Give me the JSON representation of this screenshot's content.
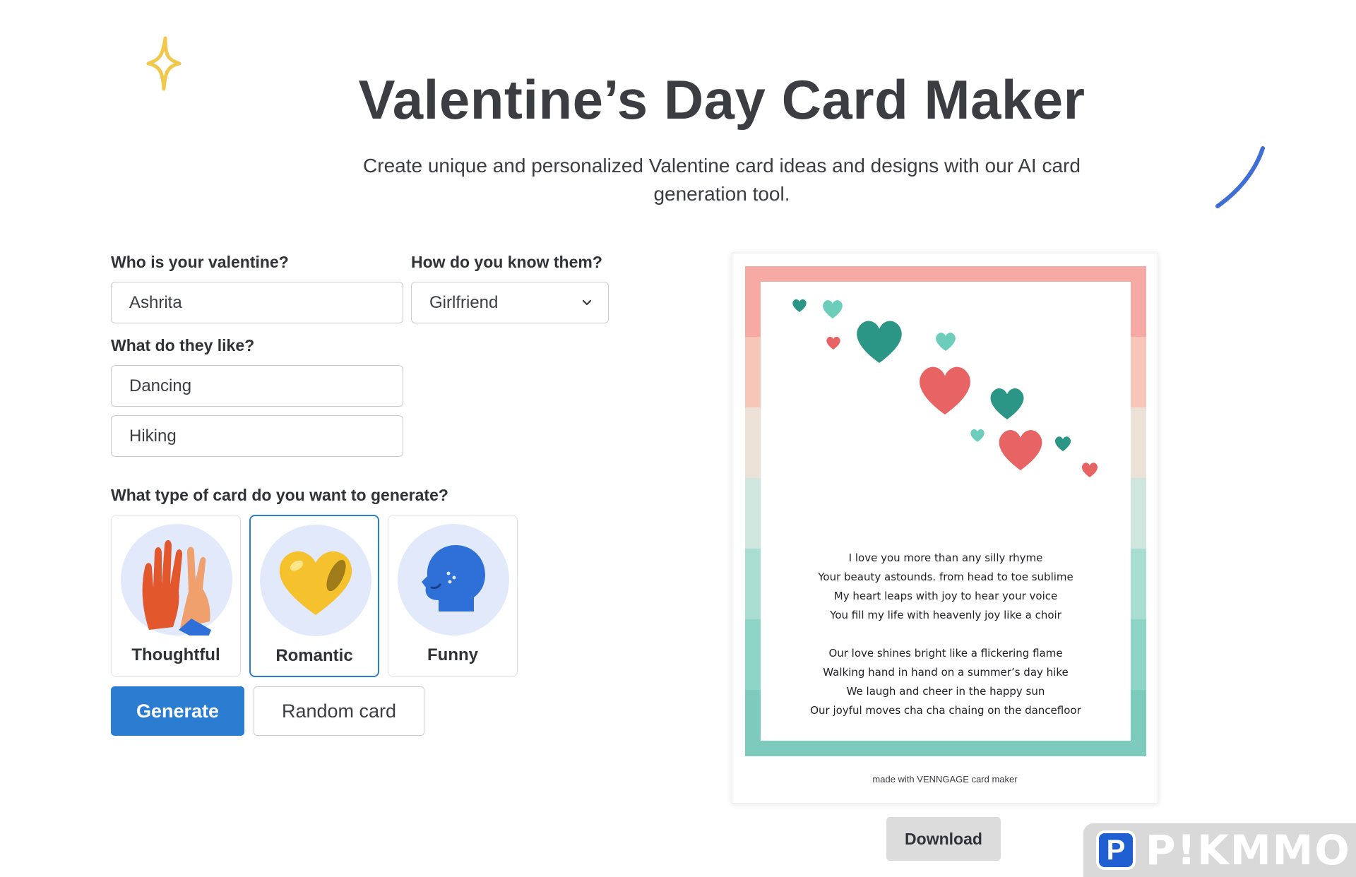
{
  "header": {
    "title": "Valentine’s Day Card Maker",
    "subtitle": "Create unique and personalized Valentine card ideas and designs with our AI card generation tool."
  },
  "form": {
    "valentine_label": "Who is your valentine?",
    "valentine_value": "Ashrita",
    "relation_label": "How do you know them?",
    "relation_value": "Girlfriend",
    "likes_label": "What do they like?",
    "like_1": "Dancing",
    "like_2": "Hiking",
    "type_label": "What type of card do you want to generate?",
    "types": [
      {
        "label": "Thoughtful",
        "icon": "high-five-icon",
        "selected": false
      },
      {
        "label": "Romantic",
        "icon": "heart-icon",
        "selected": true
      },
      {
        "label": "Funny",
        "icon": "head-icon",
        "selected": false
      }
    ],
    "generate_label": "Generate",
    "random_label": "Random card"
  },
  "card": {
    "poem": [
      [
        "I love you more than any silly rhyme",
        "Your beauty astounds. from head to toe sublime",
        "My heart leaps with joy to hear your voice",
        "You fill my life with heavenly joy like a choir"
      ],
      [
        "Our love shines bright like a flickering flame",
        "Walking hand in hand on a summer’s day hike",
        "We laugh and cheer in the happy sun",
        "Our joyful moves cha cha chaing on the dancefloor"
      ]
    ],
    "made_with": "made with VENNGAGE card maker",
    "download_label": "Download"
  },
  "watermark": {
    "icon_letter": "P",
    "text": "P!KMMO"
  },
  "colors": {
    "accent": "#2b7dd2",
    "border_stripes": [
      "#f6aaa3",
      "#f7c6b8",
      "#ede2d8",
      "#cfe6de",
      "#a9ddd2",
      "#8ed5c7",
      "#7ccbbd"
    ],
    "heart_red": "#e86464",
    "heart_teal": "#2b9686",
    "heart_mint": "#6ccdbb"
  }
}
